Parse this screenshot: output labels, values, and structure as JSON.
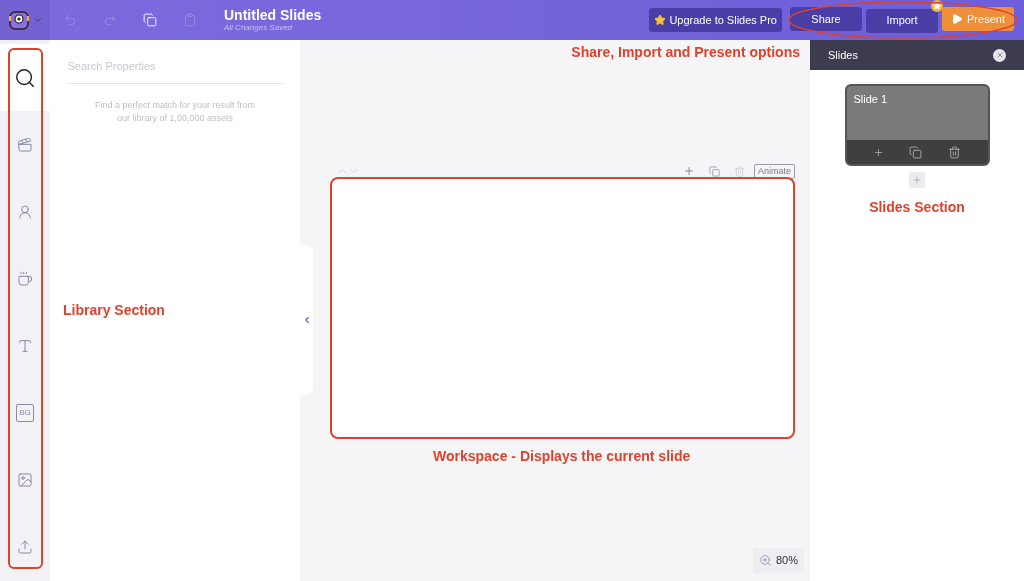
{
  "header": {
    "title": "Untitled Slides",
    "subtitle": "All Changes Saved",
    "upgrade_button": "Upgrade to Slides Pro",
    "actions": [
      {
        "label": "Share",
        "kind": "plain"
      },
      {
        "label": "Import",
        "kind": "badge"
      },
      {
        "label": "Present",
        "kind": "primary"
      }
    ]
  },
  "sidebar": {
    "items": [
      {
        "kind": "search",
        "selected": true
      },
      {
        "kind": "video",
        "selected": false
      },
      {
        "kind": "character",
        "selected": false
      },
      {
        "kind": "props",
        "selected": false
      },
      {
        "kind": "text",
        "selected": false
      },
      {
        "kind": "background",
        "label": "BG",
        "selected": false
      },
      {
        "kind": "image",
        "selected": false
      },
      {
        "kind": "upload",
        "selected": false
      }
    ]
  },
  "library": {
    "search": {
      "placeholder": "Search Properties"
    },
    "hint": "Find a perfect match for your result from our library of 1,00,000 assets"
  },
  "workspace": {
    "animate_button": "Animate",
    "zoom": "80%"
  },
  "slides_panel": {
    "title": "Slides",
    "slides": [
      {
        "label": "Slide 1",
        "selected": true
      }
    ]
  },
  "annotations": {
    "actions": "Share, Import and Present options",
    "library": "Library Section",
    "workspace": "Workspace - Displays the current slide",
    "slides": "Slides Section"
  }
}
